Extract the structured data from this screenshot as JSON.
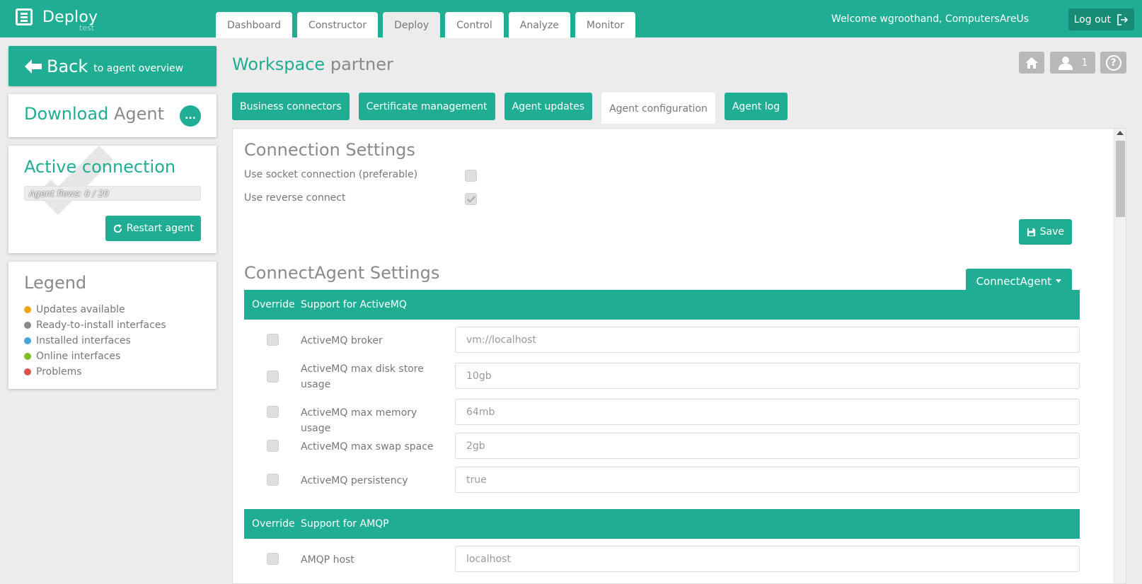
{
  "app": {
    "name": "Deploy",
    "env": "test"
  },
  "nav": {
    "tabs": [
      "Dashboard",
      "Constructor",
      "Deploy",
      "Control",
      "Analyze",
      "Monitor"
    ],
    "active": "Deploy"
  },
  "user": {
    "welcome": "Welcome wgroothand, ComputersAreUs",
    "logout_label": "Log out"
  },
  "sidebar": {
    "back": {
      "label": "Back",
      "sub": "to agent overview"
    },
    "download": {
      "title_main": "Download",
      "title_muted": "Agent",
      "more_label": "..."
    },
    "active": {
      "title": "Active connection",
      "flows_text": "Agent flows: 0 / 20",
      "flows_used": 0,
      "flows_total": 20,
      "restart_label": "Restart agent"
    },
    "legend": {
      "title": "Legend",
      "items": [
        {
          "label": "Updates available",
          "color": "#f0a30a"
        },
        {
          "label": "Ready-to-install interfaces",
          "color": "#8a8a8a"
        },
        {
          "label": "Installed interfaces",
          "color": "#45a6d8"
        },
        {
          "label": "Online interfaces",
          "color": "#7cbf26"
        },
        {
          "label": "Problems",
          "color": "#d9534f"
        }
      ]
    }
  },
  "workspace": {
    "label": "Workspace",
    "name": "partner",
    "users_count": "1",
    "help_label": "?"
  },
  "subtabs": {
    "items": [
      "Business connectors",
      "Certificate management",
      "Agent updates",
      "Agent configuration",
      "Agent log"
    ],
    "active": "Agent configuration"
  },
  "connection": {
    "title": "Connection Settings",
    "socket_label": "Use socket connection (preferable)",
    "socket_checked": false,
    "reverse_label": "Use reverse connect",
    "reverse_checked": true,
    "save_label": "Save"
  },
  "connectagent": {
    "title": "ConnectAgent Settings",
    "dropdown_label": "ConnectAgent",
    "groups": [
      {
        "override_label": "Override",
        "name": "Support for ActiveMQ",
        "rows": [
          {
            "label": "ActiveMQ broker",
            "value": "vm://localhost"
          },
          {
            "label": "ActiveMQ max disk store usage",
            "value": "10gb"
          },
          {
            "label": "ActiveMQ max memory usage",
            "value": "64mb"
          },
          {
            "label": "ActiveMQ max swap space",
            "value": "2gb"
          },
          {
            "label": "ActiveMQ persistency",
            "value": "true"
          }
        ]
      },
      {
        "override_label": "Override",
        "name": "Support for AMQP",
        "rows": [
          {
            "label": "AMQP host",
            "value": "localhost"
          }
        ]
      }
    ]
  },
  "colors": {
    "accent": "#1fae93",
    "accent_dark": "#168b76",
    "muted_button": "#b8b8b8"
  }
}
